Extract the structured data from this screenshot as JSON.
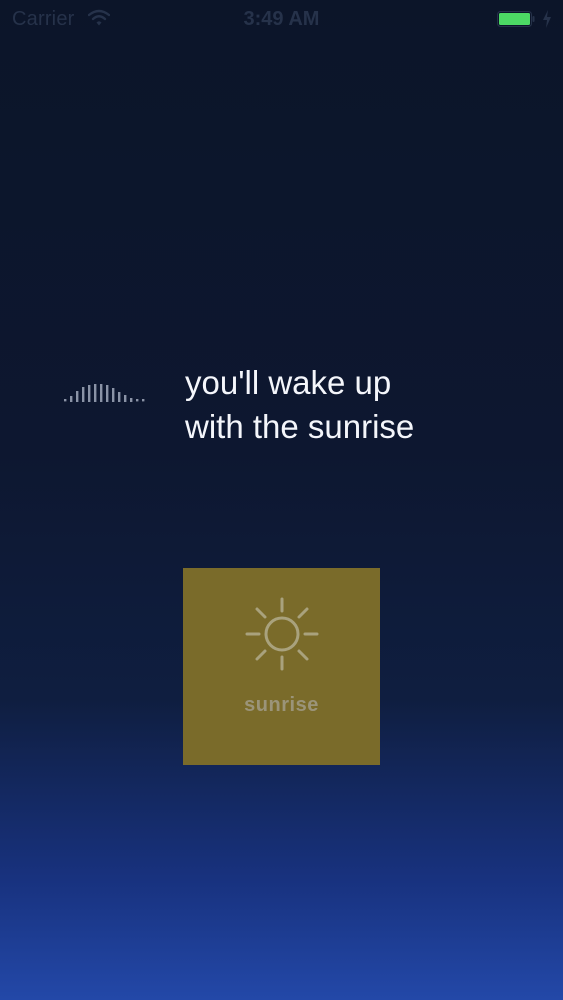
{
  "status_bar": {
    "carrier": "Carrier",
    "time": "3:49 AM",
    "battery_color": "#4cd964",
    "icons": [
      "wifi-icon",
      "battery-icon",
      "charging-bolt-icon"
    ]
  },
  "message": {
    "line1": "you'll wake up",
    "line2": "with the sunrise",
    "icon": "sound-wave-icon"
  },
  "sunrise_tile": {
    "label": "sunrise",
    "icon": "sun-icon",
    "tile_color": "#7a6b2a"
  }
}
